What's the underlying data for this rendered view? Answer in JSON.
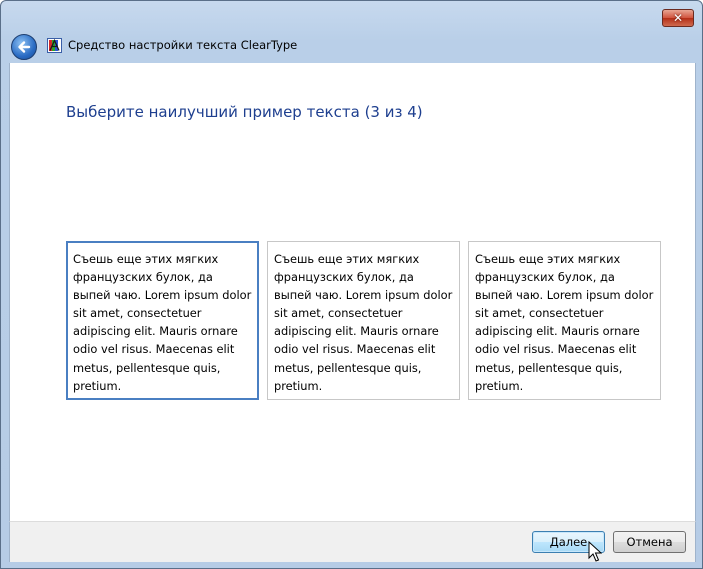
{
  "window": {
    "title": "Средство настройки текста ClearType",
    "close_glyph": "✕"
  },
  "main": {
    "heading": "Выберите наилучший пример текста (3 из 4)",
    "samples": [
      {
        "text": "Съешь еще этих мягких французских булок, да выпей чаю. Lorem ipsum dolor sit amet, consectetuer adipiscing elit. Mauris ornare odio vel risus. Maecenas elit metus, pellentesque quis, pretium.",
        "selected": true
      },
      {
        "text": "Съешь еще этих мягких французских булок, да выпей чаю. Lorem ipsum dolor sit amet, consectetuer adipiscing elit. Mauris ornare odio vel risus. Maecenas elit metus, pellentesque quis, pretium.",
        "selected": false
      },
      {
        "text": "Съешь еще этих мягких французских булок, да выпей чаю. Lorem ipsum dolor sit amet, consectetuer adipiscing elit. Mauris ornare odio vel risus. Maecenas elit metus, pellentesque quis, pretium.",
        "selected": false
      }
    ]
  },
  "footer": {
    "next_label": "Далее",
    "cancel_label": "Отмена"
  },
  "icons": {
    "back": "back-arrow-icon",
    "app": "cleartype-icon",
    "close": "close-icon",
    "cursor": "mouse-pointer-icon"
  },
  "colors": {
    "heading": "#1e3f8f",
    "selected_border": "#4a7fc2",
    "titlebar": "#b9cfe8",
    "close_button": "#c9402a"
  }
}
